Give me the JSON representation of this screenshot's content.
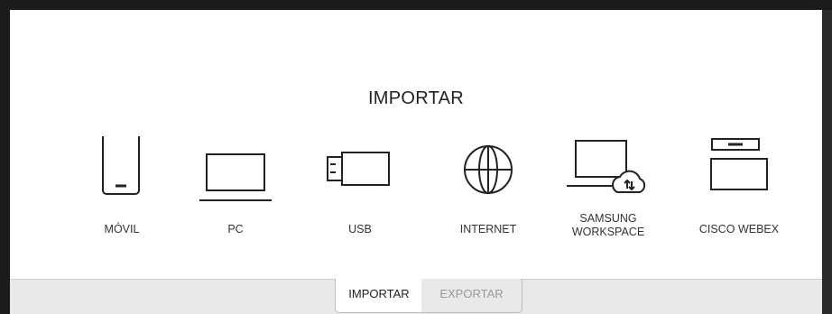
{
  "dialog": {
    "title": "IMPORTAR"
  },
  "sources": [
    {
      "label": "MÓVIL",
      "icon": "mobile-icon"
    },
    {
      "label": "PC",
      "icon": "laptop-icon"
    },
    {
      "label": "USB",
      "icon": "usb-icon"
    },
    {
      "label": "INTERNET",
      "icon": "globe-icon"
    },
    {
      "label_line1": "SAMSUNG",
      "label_line2": "WORKSPACE",
      "icon": "samsung-workspace-icon"
    },
    {
      "label": "CISCO WEBEX",
      "icon": "cisco-webex-icon"
    }
  ],
  "tabs": {
    "active": "IMPORTAR",
    "inactive": "EXPORTAR"
  },
  "colors": {
    "bezel": "#1b1b1b",
    "background": "#ffffff",
    "tabbar": "#e9e9e9",
    "icon_stroke": "#222222",
    "inactive_text": "#9a9a9a"
  }
}
